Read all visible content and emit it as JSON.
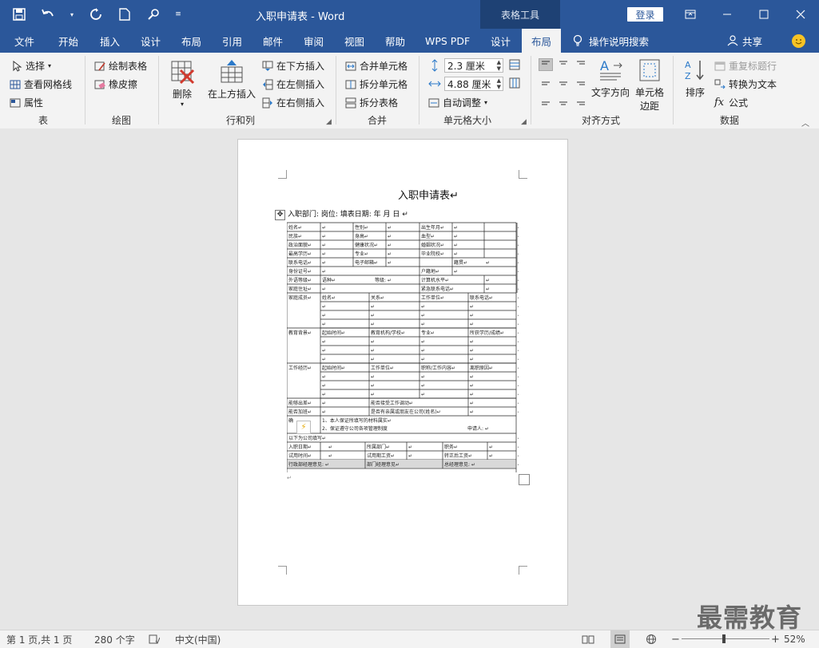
{
  "titlebar": {
    "document_title": "入职申请表  -  Word",
    "context_tab": "表格工具",
    "login": "登录"
  },
  "tabs": [
    {
      "label": "文件",
      "x": 0
    },
    {
      "label": "开始"
    },
    {
      "label": "插入"
    },
    {
      "label": "设计"
    },
    {
      "label": "布局"
    },
    {
      "label": "引用"
    },
    {
      "label": "邮件"
    },
    {
      "label": "审阅"
    },
    {
      "label": "视图"
    },
    {
      "label": "帮助"
    },
    {
      "label": "WPS PDF"
    },
    {
      "label": "设计"
    },
    {
      "label": "布局"
    }
  ],
  "tell_me": "操作说明搜索",
  "share": "共享",
  "ribbon": {
    "table": {
      "label": "表",
      "select": "选择",
      "view_gridlines": "查看网格线",
      "properties": "属性"
    },
    "draw": {
      "label": "绘图",
      "draw_table": "绘制表格",
      "eraser": "橡皮擦"
    },
    "rows_cols": {
      "label": "行和列",
      "delete": "删除",
      "insert_above": "在上方插入",
      "insert_below": "在下方插入",
      "insert_left": "在左侧插入",
      "insert_right": "在右侧插入"
    },
    "merge": {
      "label": "合并",
      "merge_cells": "合并单元格",
      "split_cells": "拆分单元格",
      "split_table": "拆分表格"
    },
    "cell_size": {
      "label": "单元格大小",
      "height": "2.3 厘米",
      "width": "4.88 厘米",
      "autofit": "自动调整"
    },
    "alignment": {
      "label": "对齐方式",
      "text_direction": "文字方向",
      "cell_margins_1": "单元格",
      "cell_margins_2": "边距"
    },
    "data": {
      "label": "数据",
      "sort": "排序",
      "repeat_header": "重复标题行",
      "convert_to_text": "转换为文本",
      "formula": "公式"
    }
  },
  "document": {
    "title": "入职申请表↵",
    "header_line": "入职部门:      岗位:    填表日期:     年     月     日          ↵",
    "table_rows": [
      [
        "姓名↵",
        "性别↵",
        "出生年月↵"
      ],
      [
        "民族↵",
        "身高↵",
        "血型↵"
      ],
      [
        "政治面貌↵",
        "健康状况↵",
        "婚姻状况↵"
      ],
      [
        "最高学历↵",
        "专业↵",
        "毕业院校↵"
      ],
      [
        "联系电话↵",
        "电子邮箱↵",
        "籍贯↵"
      ],
      [
        "身份证号↵",
        "户籍地↵"
      ],
      [
        "外语等级↵",
        "语种↵",
        "等级: ↵",
        "计算机水平↵"
      ],
      [
        "家庭住址↵",
        "紧急联系电话↵"
      ]
    ],
    "family_label": "家庭成员↵",
    "family_headers": [
      "姓名↵",
      "关系↵",
      "工作单位↵",
      "联系电话↵"
    ],
    "edu_label": "教育背景↵",
    "edu_headers": [
      "起始时间↵",
      "教育机构/学校↵",
      "专业↵",
      "所获学历/成绩↵"
    ],
    "work_label": "工作经历↵",
    "work_headers": [
      "起始时间↵",
      "工作单位↵",
      "职称/工作内容↵",
      "离职原因↵"
    ],
    "travel_label": "能够出差↵",
    "overtime_label": "能否加班↵",
    "transfer_q": "能否接受工作调动↵",
    "relatives_q": "是否有亲属或朋友在公司(姓名)↵",
    "remark_label": "确",
    "pledge_1": "1、本人保证所填写的材料属实↵",
    "pledge_2": "2、保证遵守公司各项管理制度",
    "applicant": "申请人: ↵",
    "company_fill": "以下为公司填写↵",
    "onboard_date": "入职日期↵",
    "dept": "所属部门↵",
    "position": "职务↵",
    "trial_time": "试用时间↵",
    "trial_salary": "试用期工资↵",
    "regular_salary": "转正后工资↵",
    "admin_opinion": "行政部经理意见: ↵",
    "dept_opinion": "部门经理意见↵",
    "gm_opinion": "总经理意见: ↵",
    "end_mark": "↵"
  },
  "statusbar": {
    "page": "第 1 页,共 1 页",
    "words": "280 个字",
    "language": "中文(中国)",
    "zoom": "52%"
  },
  "watermark": "最需教育",
  "colors": {
    "accent": "#2b579a",
    "context": "#1e4174"
  }
}
